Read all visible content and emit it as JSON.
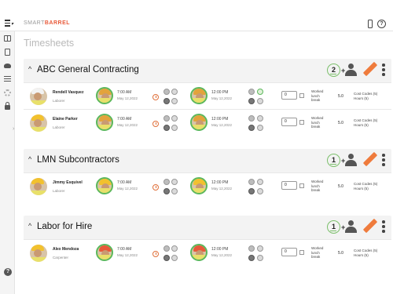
{
  "app": {
    "logo_prefix": "SMART",
    "logo_brand": "BARREL",
    "page_title": "Timesheets"
  },
  "sidebar": {
    "icons": [
      "book-icon",
      "document-icon",
      "users-icon",
      "list-icon",
      "gear-icon",
      "lock-icon",
      "help-icon"
    ]
  },
  "labels": {
    "worked_lunch_break": "Worked lunch break",
    "cost_codes_hours": "Cost Codes (5) Hours (5)"
  },
  "sections": [
    {
      "name": "ABC General Contracting",
      "count": "2",
      "workers": [
        {
          "name": "Rendell Vasquez",
          "role": "Laborer",
          "in_time": "7:00 AM",
          "in_date": "May 12,2022",
          "out_time": "12:00 PM",
          "out_date": "May 12,2022",
          "lunch": "0",
          "hours": "5.0"
        },
        {
          "name": "Elaine Parker",
          "role": "Laborer",
          "in_time": "7:00 AM",
          "in_date": "May 12,2022",
          "out_time": "12:00 PM",
          "out_date": "May 12,2022",
          "lunch": "0",
          "hours": "5.0"
        }
      ]
    },
    {
      "name": "LMN Subcontractors",
      "count": "1",
      "workers": [
        {
          "name": "Jimmy Esquivel",
          "role": "Laborer",
          "in_time": "7:00 AM",
          "in_date": "May 12,2022",
          "out_time": "12:00 PM",
          "out_date": "May 12,2022",
          "lunch": "0",
          "hours": "5.0"
        }
      ]
    },
    {
      "name": "Labor for Hire",
      "count": "1",
      "workers": [
        {
          "name": "Alex Mendoza",
          "role": "Carpenter",
          "in_time": "7:00 AM",
          "in_date": "May 12,2022",
          "out_time": "12:00 PM",
          "out_date": "May 12,2022",
          "lunch": "0",
          "hours": "5.0"
        }
      ]
    }
  ],
  "colors": {
    "accent_orange": "#ef7b3c",
    "status_green": "#5cb85c",
    "section_bg": "#f3f3f3"
  }
}
